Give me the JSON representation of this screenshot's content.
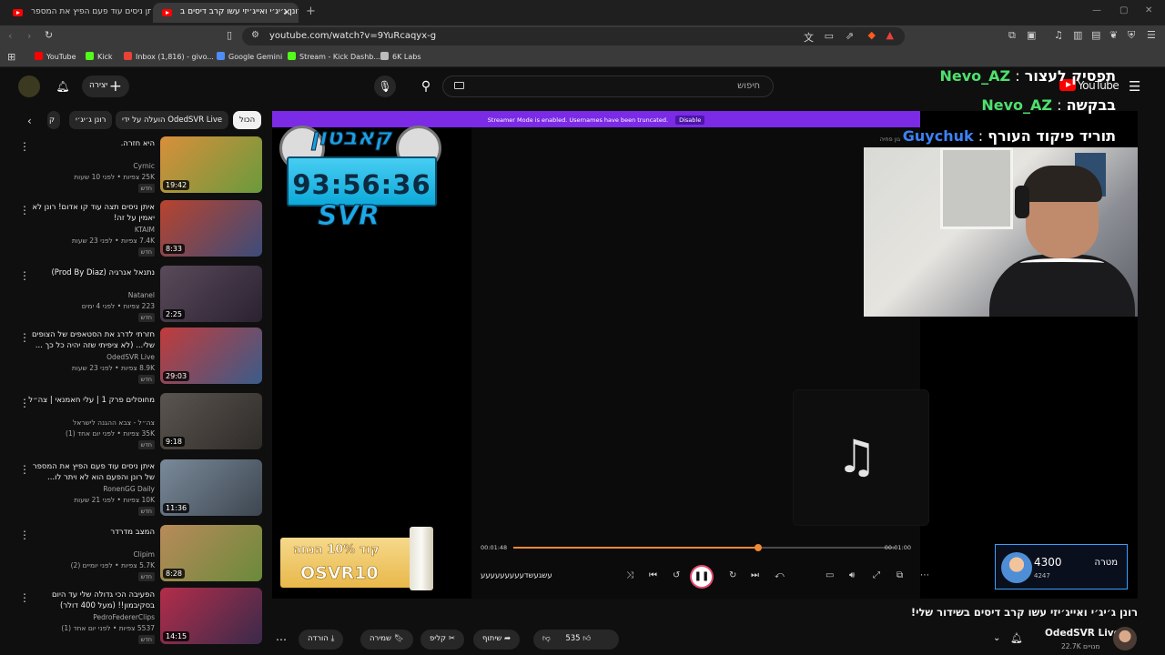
{
  "browser": {
    "tabs": [
      {
        "title": "איתן ניסים עוד פעם הפיץ את המספר"
      },
      {
        "title": "רונן ג׳יג׳י ואייג׳יזי עשו קרב דיסים ב"
      }
    ],
    "url": "youtube.com/watch?v=9YuRcaqyx-g",
    "bookmarks": [
      {
        "label": "YouTube",
        "color": "#ff0000"
      },
      {
        "label": "Kick",
        "color": "#53fc18"
      },
      {
        "label": "Inbox (1,816) - givo...",
        "color": "#ea4335"
      },
      {
        "label": "Google Gemini",
        "color": "#4e8cf7"
      },
      {
        "label": "Stream - Kick Dashb...",
        "color": "#53fc18"
      },
      {
        "label": "6K Labs",
        "color": "#bbbbbb"
      }
    ]
  },
  "header": {
    "create_label": "יצירה",
    "search_placeholder": "חיפוש",
    "logo_text": "YouTube"
  },
  "chips": [
    "הכול",
    "הועלה על ידי OdedSVR Live",
    "רונן ג׳יג׳י"
  ],
  "recommendations": [
    {
      "title": "היא חזרה.",
      "channel": "Cyrnic",
      "meta": "25K צפיות • לפני 10 שעות",
      "badge": "חדש",
      "duration": "19:42",
      "c1": "#d98f3b",
      "c2": "#6a9a3c"
    },
    {
      "title": "איתן ניסים תצה עוד קו אדום! רונן לא יאמין על זה!",
      "channel": "KTAIM",
      "meta": "7.4K צפיות • לפני 23 שעות",
      "badge": "חדש",
      "duration": "8:33",
      "c1": "#b9432e",
      "c2": "#3c4c7a"
    },
    {
      "title": "נתנאל אנרגיה (Prod By Diaz)",
      "channel": "Natanel",
      "meta": "223 צפיות • לפני 4 ימים",
      "badge": "חדש",
      "duration": "2:25",
      "c1": "#5a4a5a",
      "c2": "#2a2230"
    },
    {
      "title": "חזרתי לדרג את הסטאפים של הצופים שלי... (לא ציפיתי שזה יהיה כל כך ...",
      "channel": "OdedSVR Live",
      "meta": "8.9K צפיות • לפני 23 שעות",
      "badge": "חדש",
      "duration": "29:03",
      "c1": "#c23b3b",
      "c2": "#3a5c8a"
    },
    {
      "title": "מחוסלים פרק 1 | עלי חאמנאי | צה״ל",
      "channel": "צה״ל - צבא ההגנה לישראל",
      "meta": "35K צפיות • לפני יום אחד (1)",
      "badge": "חדש",
      "duration": "9:18",
      "c1": "#5a5550",
      "c2": "#2f2b28"
    },
    {
      "title": "איתן ניסים עוד פעם הפיץ את המספר של רונן והפעם הוא לא ויתר לו...",
      "channel": "RonenGG Daily",
      "meta": "10K צפיות • לפני 21 שעות",
      "badge": "חדש",
      "duration": "11:36",
      "c1": "#7a8a9a",
      "c2": "#3d4650"
    },
    {
      "title": "המצב מדרדר",
      "channel": "Clipim",
      "meta": "5.7K צפיות • לפני יומיים (2)",
      "badge": "חדש",
      "duration": "8:28",
      "c1": "#b98a5a",
      "c2": "#6a8a3a"
    },
    {
      "title": "הפעיבה הכי גדולה שלי עד היום בסקיבמון!! (מעל 400 דולר)",
      "channel": "PedroFedererClips",
      "meta": "5537 צפיות • לפני יום אחד (1)",
      "badge": "חדש",
      "duration": "14:15",
      "c1": "#b32d4a",
      "c2": "#3a2a4a"
    }
  ],
  "video": {
    "streamer_banner": "Streamer Mode is enabled. Usernames have been truncated.",
    "disable_label": "Disable",
    "overlay_title": "קאבטון",
    "timer": "93:56:36",
    "overlay_brand": "SVR",
    "player_top": "גון פחיה",
    "time_current": "00:01:48",
    "time_total": "00:01:00",
    "progress": 0.64,
    "song": "עשגעשדעעעעעעעעע",
    "promo_line1": "קוד 10% הנחה",
    "promo_line2": "OSVR10",
    "chat": [
      {
        "user": "Nevo_AZ",
        "msg": "תפסיק לעצור"
      },
      {
        "user": "Nevo_AZ",
        "msg": "בבקשה"
      },
      {
        "user": "Guychuk",
        "msg": "תוריד פיקוד העורף"
      }
    ],
    "goal_value": "4300",
    "goal_sub": "4247",
    "goal_label": "מטרה"
  },
  "meta": {
    "title": "רונן ג׳יג׳י ואייג׳יזי עשו קרב דיסים בשידור שלי!",
    "channel": "OdedSVR Live",
    "subs": "22.7K מנויים",
    "likes": "535",
    "share": "שיתוף",
    "clip": "קליפ",
    "save": "שמירה",
    "download": "הורדה"
  }
}
